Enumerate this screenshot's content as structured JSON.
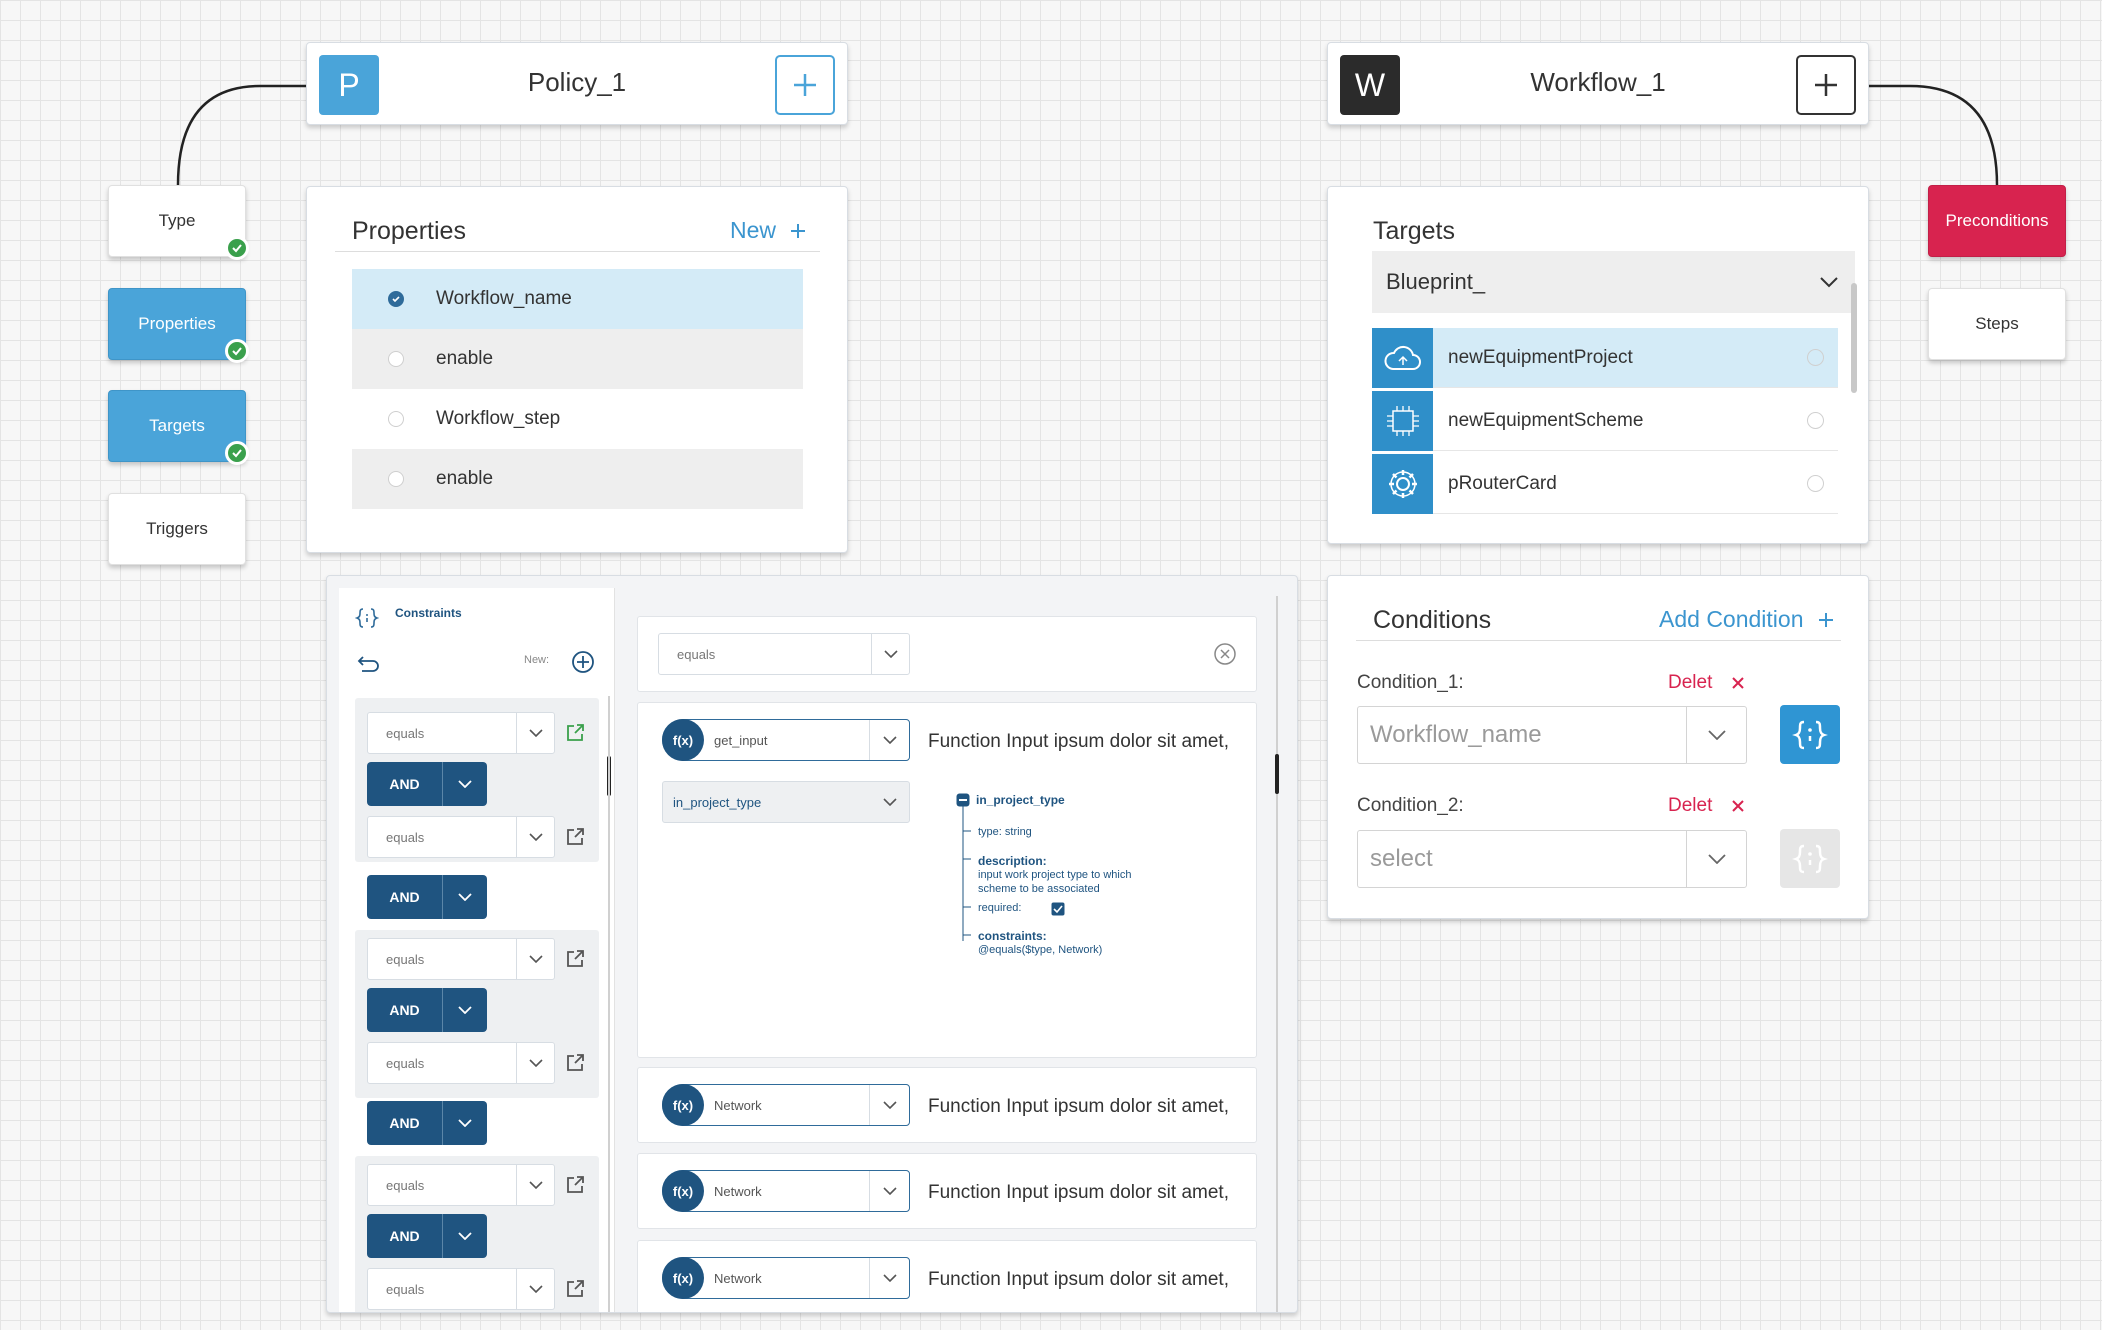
{
  "policy": {
    "badge": "P",
    "title": "Policy_1",
    "badge_color": "#4aa4d9"
  },
  "workflow": {
    "badge": "W",
    "title": "Workflow_1",
    "badge_color": "#2b2b2b"
  },
  "left_nav": {
    "type": "Type",
    "properties": "Properties",
    "targets": "Targets",
    "triggers": "Triggers"
  },
  "right_nav": {
    "preconditions": "Preconditions",
    "steps": "Steps"
  },
  "properties": {
    "title": "Properties",
    "new_label": "New",
    "items": [
      {
        "label": "Workflow_name",
        "selected": true
      },
      {
        "label": "enable",
        "selected": false
      },
      {
        "label": "Workflow_step",
        "selected": false
      },
      {
        "label": "enable",
        "selected": false
      }
    ]
  },
  "targets": {
    "title": "Targets",
    "dropdown": "Blueprint_",
    "items": [
      {
        "label": "newEquipmentProject",
        "icon": "cloud-icon"
      },
      {
        "label": "newEquipmentScheme",
        "icon": "chip-icon"
      },
      {
        "label": "pRouterCard",
        "icon": "gear-icon"
      }
    ]
  },
  "conditions": {
    "title": "Conditions",
    "add_label": "Add Condition",
    "items": [
      {
        "label": "Condition_1:",
        "delete": "Delet",
        "value": "Workflow_name"
      },
      {
        "label": "Condition_2:",
        "delete": "Delet",
        "value": "select"
      }
    ]
  },
  "constraints": {
    "title": "Constraints",
    "new_label": "New:",
    "top_select": "equals",
    "left_selects": [
      "equals",
      "equals",
      "equals",
      "equals",
      "equals",
      "equals"
    ],
    "and_label": "AND",
    "functions": [
      {
        "fx": "f(x)",
        "select": "get_input",
        "text": "Function Input  ipsum dolor sit amet,"
      },
      {
        "fx": "f(x)",
        "select": "Network",
        "text": "Function Input  ipsum dolor sit amet,"
      },
      {
        "fx": "f(x)",
        "select": "Network",
        "text": "Function Input  ipsum dolor sit amet,"
      },
      {
        "fx": "f(x)",
        "select": "Network",
        "text": "Function Input  ipsum dolor sit amet,"
      }
    ],
    "input_select": "in_project_type",
    "tree": {
      "root": "in_project_type",
      "type": "type: string",
      "description_label": "description:",
      "description_text_1": "input work project type to which",
      "description_text_2": "scheme to be associated",
      "required_label": "required:",
      "constraints_label": "constraints:",
      "constraints_value": "@equals($type, Network)"
    }
  },
  "colors": {
    "accent_blue": "#4aa4d9",
    "dark_blue": "#1f5480",
    "red": "#d8234f",
    "green": "#3aa04c"
  }
}
